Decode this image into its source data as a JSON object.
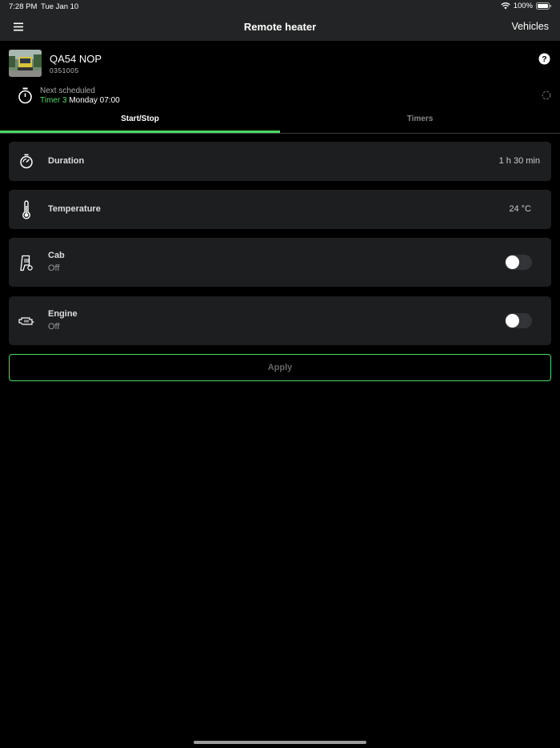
{
  "status_bar": {
    "time": "7:28 PM",
    "date": "Tue Jan 10",
    "battery": "100%"
  },
  "nav": {
    "title": "Remote heater",
    "vehicles_label": "Vehicles"
  },
  "vehicle": {
    "name": "QA54 NOP",
    "id": "0351005"
  },
  "schedule": {
    "label": "Next scheduled",
    "timer_name": "Timer 3",
    "when": "Monday 07:00"
  },
  "tabs": [
    {
      "label": "Start/Stop",
      "active": true
    },
    {
      "label": "Timers",
      "active": false
    }
  ],
  "settings": {
    "duration": {
      "label": "Duration",
      "value": "1 h 30 min",
      "icon": "stopwatch-icon"
    },
    "temperature": {
      "label": "Temperature",
      "value": "24 °C",
      "icon": "thermometer-icon"
    },
    "cab": {
      "label": "Cab",
      "state": "Off",
      "icon": "cab-heater-icon",
      "on": false
    },
    "engine": {
      "label": "Engine",
      "state": "Off",
      "icon": "engine-icon",
      "on": false
    }
  },
  "apply_label": "Apply",
  "colors": {
    "accent": "#4cd964",
    "card": "#1d1e20",
    "nav": "#232425"
  }
}
